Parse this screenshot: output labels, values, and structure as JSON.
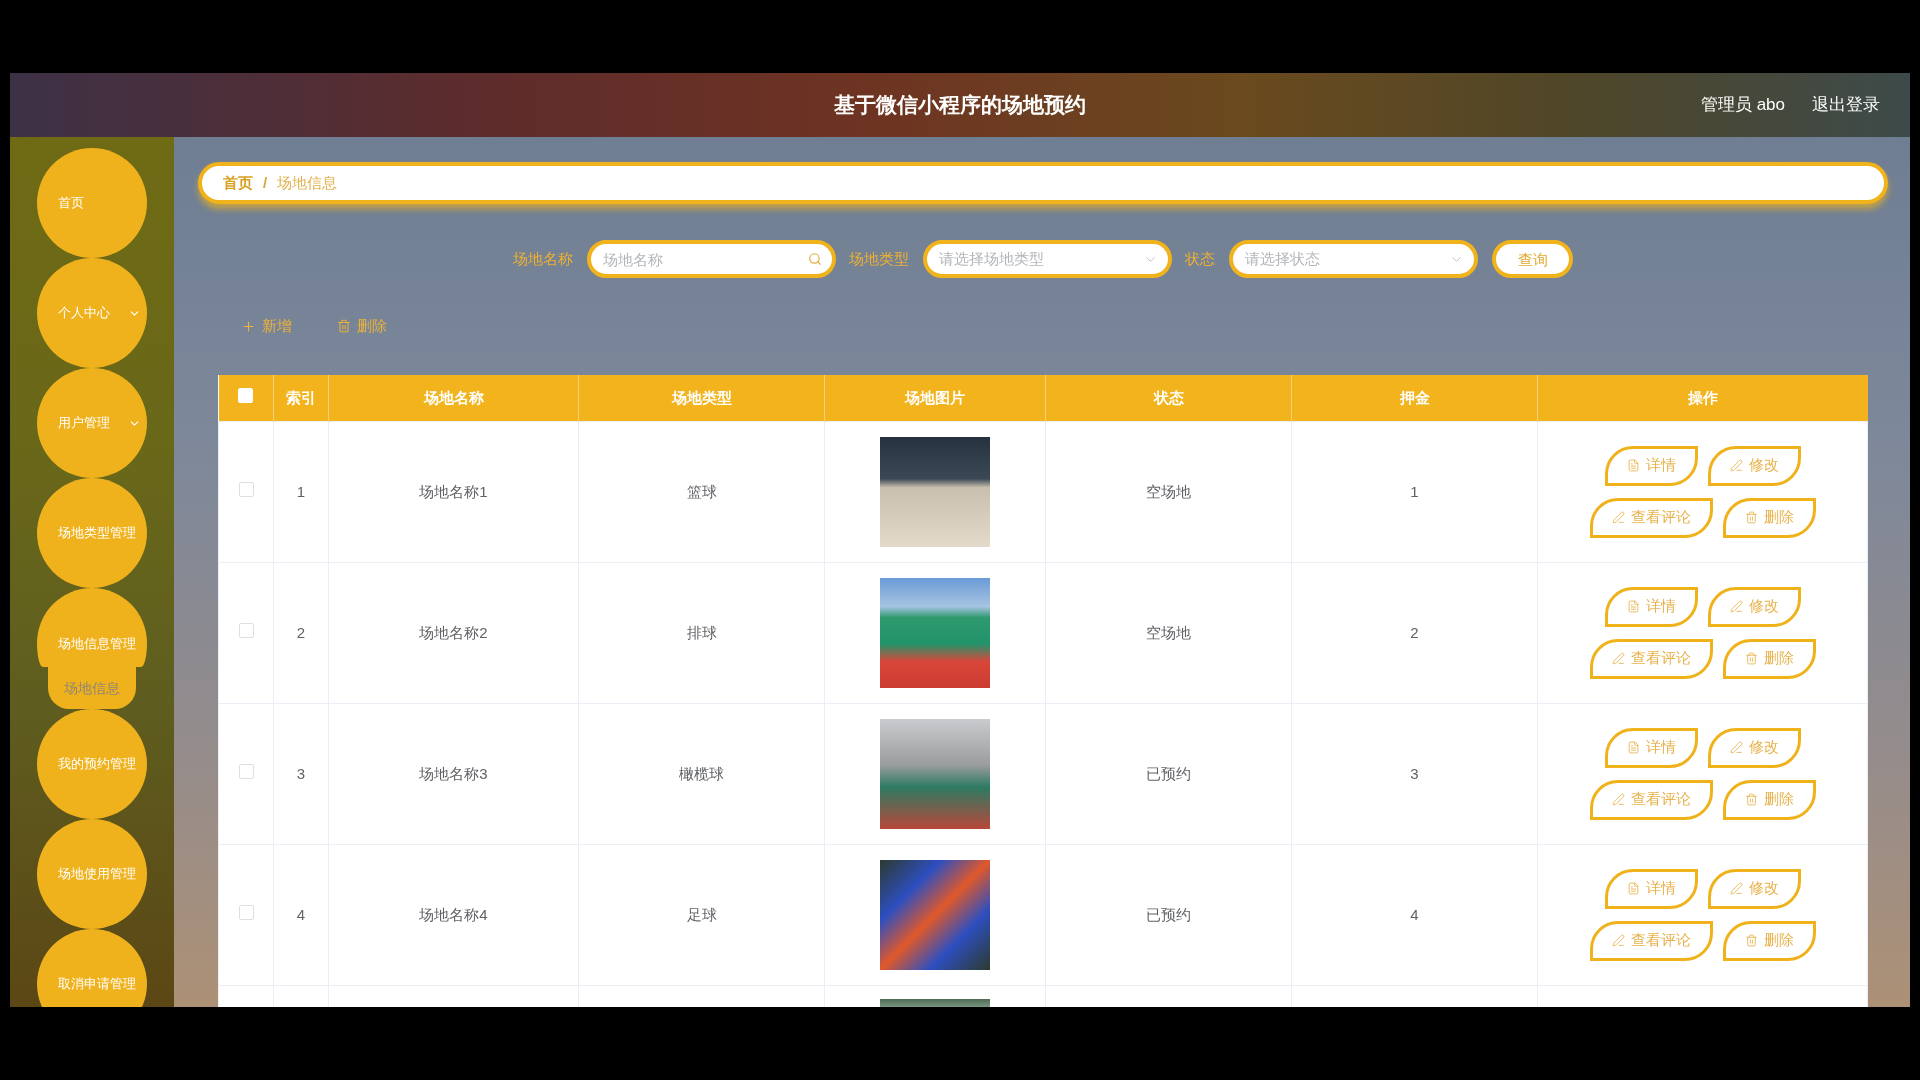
{
  "header": {
    "title": "基于微信小程序的场地预约",
    "user": "管理员 abo",
    "logout": "退出登录"
  },
  "sidebar": {
    "items": [
      {
        "label": "首页",
        "kind": "link"
      },
      {
        "label": "个人中心",
        "kind": "menu",
        "expanded": false
      },
      {
        "label": "用户管理",
        "kind": "menu",
        "expanded": false
      },
      {
        "label": "场地类型管理",
        "kind": "link"
      },
      {
        "label": "场地信息管理",
        "kind": "menu",
        "expanded": true,
        "children": [
          {
            "label": "场地信息"
          }
        ]
      },
      {
        "label": "我的预约管理",
        "kind": "link"
      },
      {
        "label": "场地使用管理",
        "kind": "link"
      },
      {
        "label": "取消申请管理",
        "kind": "link"
      }
    ]
  },
  "breadcrumb": {
    "items": [
      "首页",
      "场地信息"
    ],
    "separator": "/"
  },
  "search": {
    "fields": [
      {
        "label": "场地名称",
        "kind": "text",
        "placeholder": "场地名称"
      },
      {
        "label": "场地类型",
        "kind": "select",
        "placeholder": "请选择场地类型"
      },
      {
        "label": "状态",
        "kind": "select",
        "placeholder": "请选择状态"
      }
    ],
    "button": "查询"
  },
  "toolbar": [
    {
      "label": "新增",
      "kind": "add"
    },
    {
      "label": "删除",
      "kind": "delete"
    }
  ],
  "table": {
    "select_all": false,
    "columns": [
      "索引",
      "场地名称",
      "场地类型",
      "场地图片",
      "状态",
      "押金",
      "操作"
    ],
    "rows": [
      {
        "checked": false,
        "index": "1",
        "name": "场地名称1",
        "type": "篮球",
        "status": "空场地",
        "deposit": "1",
        "actions": [
          {
            "label": "详情",
            "kind": "detail"
          },
          {
            "label": "修改",
            "kind": "edit"
          },
          {
            "label": "查看评论",
            "kind": "comments"
          },
          {
            "label": "删除",
            "kind": "delete"
          }
        ]
      },
      {
        "checked": false,
        "index": "2",
        "name": "场地名称2",
        "type": "排球",
        "status": "空场地",
        "deposit": "2",
        "actions": [
          {
            "label": "详情",
            "kind": "detail"
          },
          {
            "label": "修改",
            "kind": "edit"
          },
          {
            "label": "查看评论",
            "kind": "comments"
          },
          {
            "label": "删除",
            "kind": "delete"
          }
        ]
      },
      {
        "checked": false,
        "index": "3",
        "name": "场地名称3",
        "type": "橄榄球",
        "status": "已预约",
        "deposit": "3",
        "actions": [
          {
            "label": "详情",
            "kind": "detail"
          },
          {
            "label": "修改",
            "kind": "edit"
          },
          {
            "label": "查看评论",
            "kind": "comments"
          },
          {
            "label": "删除",
            "kind": "delete"
          }
        ]
      },
      {
        "checked": false,
        "index": "4",
        "name": "场地名称4",
        "type": "足球",
        "status": "已预约",
        "deposit": "4",
        "actions": [
          {
            "label": "详情",
            "kind": "detail"
          },
          {
            "label": "修改",
            "kind": "edit"
          },
          {
            "label": "查看评论",
            "kind": "comments"
          },
          {
            "label": "删除",
            "kind": "delete"
          }
        ]
      }
    ]
  }
}
